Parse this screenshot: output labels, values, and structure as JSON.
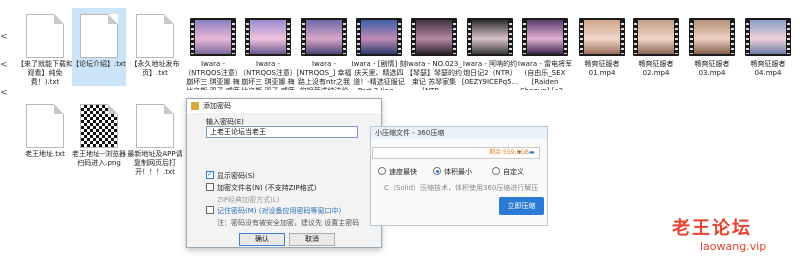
{
  "files": [
    {
      "name": "【来了就能下载和观看】纯免费！).txt",
      "type": "txt",
      "selected": false
    },
    {
      "name": "【论坛介绍】.txt",
      "type": "txt",
      "selected": true
    },
    {
      "name": "【永久地址发布页】.txt",
      "type": "txt",
      "selected": false
    },
    {
      "name": "Iwara - （NTRQOS注意）崩坏三 琪亚娜 梅比乌斯 双子 威廉 斯...",
      "type": "mp4",
      "selected": false
    },
    {
      "name": "Iwara - （NTRQOS注意）崩坏三 琪亚娜 梅比乌斯 双子 威廉 斯...",
      "type": "mp4",
      "selected": false
    },
    {
      "name": "Iwara - [NTRQOS_] 幸福路上没有ntr之我的坦蒂诺纯洁伦娜...",
      "type": "mp4",
      "selected": false
    },
    {
      "name": "Iwara - [剧情] 刻庆天里、精选四道！-精选征服记 Part 2 Jing...",
      "type": "mp4",
      "selected": false
    },
    {
      "name": "Iwara - NO.023_【琴瑟】琴瑟的约束记 苏琴家集 [NTR...",
      "type": "mp4",
      "selected": false
    },
    {
      "name": "Iwara - 阿呐的约炮日记2（NTR）[0EZY9ICEPq5...",
      "type": "mp4",
      "selected": false
    },
    {
      "name": "Iwara - 雷电将军(自由乐_SEX [Raiden Shogun] [a2...",
      "type": "mp4",
      "selected": false
    },
    {
      "name": "畅爽征服者01.mp4",
      "type": "mp4",
      "selected": false
    },
    {
      "name": "畅爽征服者02.mp4",
      "type": "mp4",
      "selected": false
    },
    {
      "name": "畅爽征服者03.mp4",
      "type": "mp4",
      "selected": false
    },
    {
      "name": "畅爽征服者04.mp4",
      "type": "mp4",
      "selected": false
    },
    {
      "name": "老王地址.txt",
      "type": "txt",
      "selected": false
    },
    {
      "name": "老王地址--浏览器扫码进入.png",
      "type": "png",
      "selected": false
    },
    {
      "name": "最新地址及APP请复制网页后打开！！！.txt",
      "type": "txt",
      "selected": false
    }
  ],
  "add_password_dialog": {
    "title": "添加密码",
    "password_label": "输入密码(E)",
    "password_value": "上老王论坛当老王",
    "show_password": "显示密码(S)",
    "encrypt_filenames": "加密文件名(N) (不支持ZIP格式)",
    "zip_legacy": "ZIP经典加密方式(L)",
    "remember_password": "记住密码(M) (对设备应用密码等窗口中)",
    "note": "注：密码没有被安全加密，建议先 设置主密码",
    "ok": "确认",
    "cancel": "取消"
  },
  "compress_dialog": {
    "title": "小压缩文件 - 360压缩",
    "disk_free": "剩余:559.8GB",
    "options": [
      "速度最快",
      "体积最小",
      "自定义"
    ],
    "selected_option": "体积最小",
    "hint": "C（Solid）压缩技术，体积使用360压缩进行解压",
    "start_button": "立即压缩"
  },
  "watermark": {
    "cn": "老王论坛",
    "url": "laowang.vip"
  },
  "colors": {
    "accent": "#2b7bd6",
    "watermark": "#e8412f",
    "selection": "#cce4f7"
  }
}
